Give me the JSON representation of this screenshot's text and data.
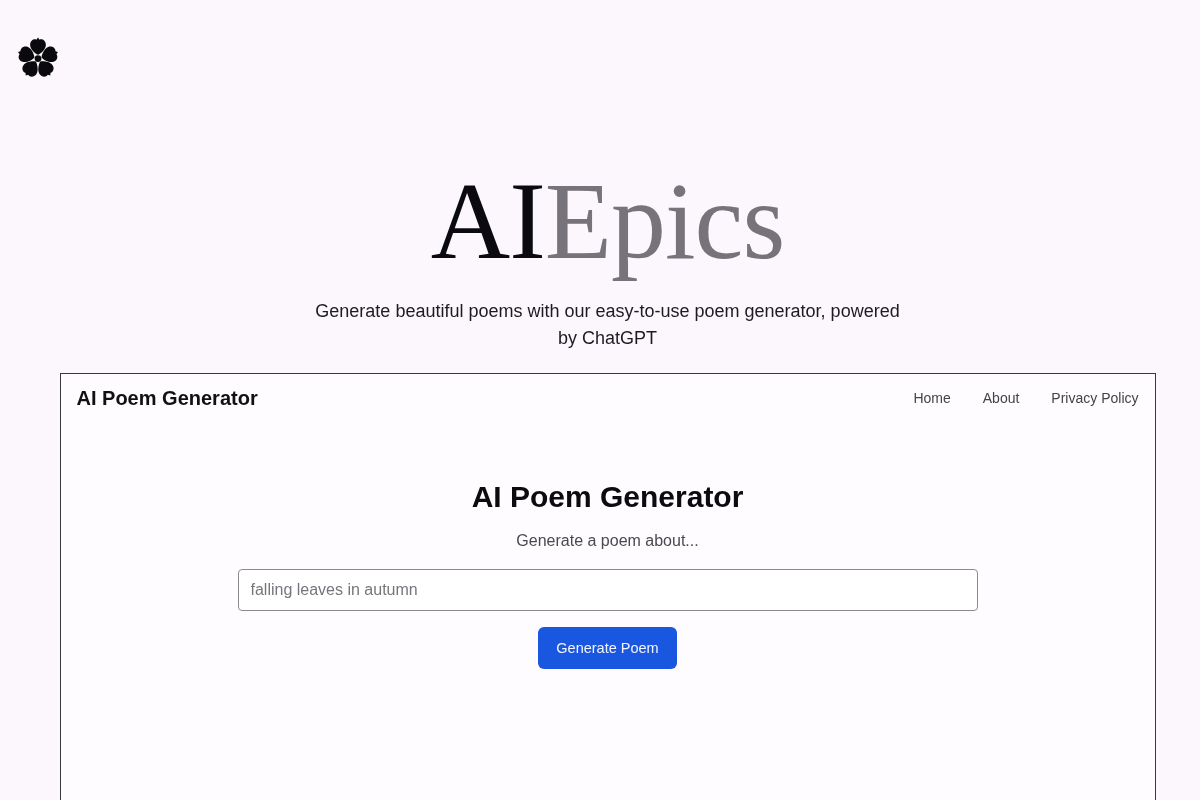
{
  "logo": {
    "lead": "AI",
    "rest": "Epics"
  },
  "tagline": "Generate beautiful poems with our easy-to-use poem generator, powered by ChatGPT",
  "preview": {
    "brand": "AI Poem Generator",
    "nav": [
      {
        "label": "Home"
      },
      {
        "label": "About"
      },
      {
        "label": "Privacy Policy"
      }
    ],
    "heading": "AI Poem Generator",
    "prompt": "Generate a poem about...",
    "topic_field": {
      "placeholder": "falling leaves in autumn"
    },
    "submit": "Generate Poem"
  }
}
